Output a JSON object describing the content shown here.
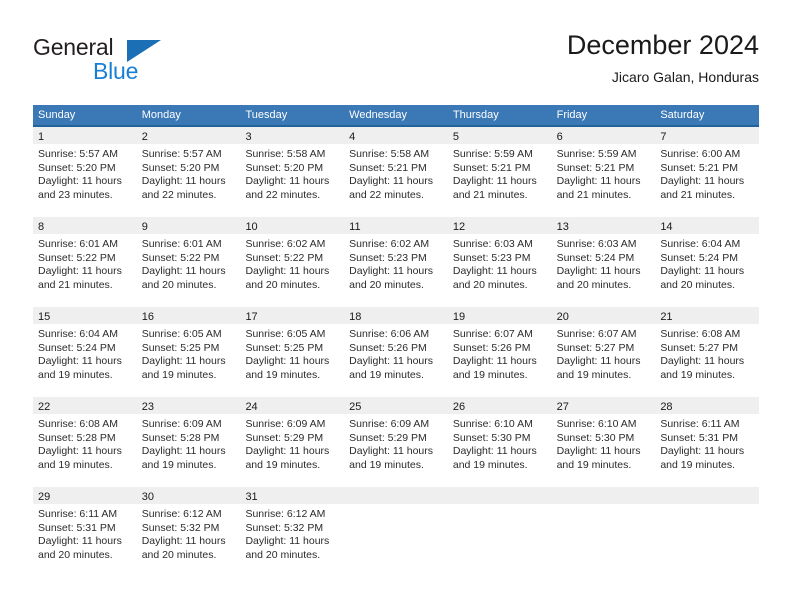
{
  "logo": {
    "word1": "General",
    "word2": "Blue",
    "triangle_color": "#1a6fb5",
    "blue_color": "#1a7fd4"
  },
  "header": {
    "title": "December 2024",
    "subtitle": "Jicaro Galan, Honduras"
  },
  "theme": {
    "header_bg": "#3b78b6",
    "row_divider": "#20639b",
    "daynum_bg": "#efefef",
    "text": "#2b2b2b"
  },
  "weekdays": [
    "Sunday",
    "Monday",
    "Tuesday",
    "Wednesday",
    "Thursday",
    "Friday",
    "Saturday"
  ],
  "weeks": [
    [
      {
        "day": "1",
        "sunrise": "Sunrise: 5:57 AM",
        "sunset": "Sunset: 5:20 PM",
        "daylight1": "Daylight: 11 hours",
        "daylight2": "and 23 minutes."
      },
      {
        "day": "2",
        "sunrise": "Sunrise: 5:57 AM",
        "sunset": "Sunset: 5:20 PM",
        "daylight1": "Daylight: 11 hours",
        "daylight2": "and 22 minutes."
      },
      {
        "day": "3",
        "sunrise": "Sunrise: 5:58 AM",
        "sunset": "Sunset: 5:20 PM",
        "daylight1": "Daylight: 11 hours",
        "daylight2": "and 22 minutes."
      },
      {
        "day": "4",
        "sunrise": "Sunrise: 5:58 AM",
        "sunset": "Sunset: 5:21 PM",
        "daylight1": "Daylight: 11 hours",
        "daylight2": "and 22 minutes."
      },
      {
        "day": "5",
        "sunrise": "Sunrise: 5:59 AM",
        "sunset": "Sunset: 5:21 PM",
        "daylight1": "Daylight: 11 hours",
        "daylight2": "and 21 minutes."
      },
      {
        "day": "6",
        "sunrise": "Sunrise: 5:59 AM",
        "sunset": "Sunset: 5:21 PM",
        "daylight1": "Daylight: 11 hours",
        "daylight2": "and 21 minutes."
      },
      {
        "day": "7",
        "sunrise": "Sunrise: 6:00 AM",
        "sunset": "Sunset: 5:21 PM",
        "daylight1": "Daylight: 11 hours",
        "daylight2": "and 21 minutes."
      }
    ],
    [
      {
        "day": "8",
        "sunrise": "Sunrise: 6:01 AM",
        "sunset": "Sunset: 5:22 PM",
        "daylight1": "Daylight: 11 hours",
        "daylight2": "and 21 minutes."
      },
      {
        "day": "9",
        "sunrise": "Sunrise: 6:01 AM",
        "sunset": "Sunset: 5:22 PM",
        "daylight1": "Daylight: 11 hours",
        "daylight2": "and 20 minutes."
      },
      {
        "day": "10",
        "sunrise": "Sunrise: 6:02 AM",
        "sunset": "Sunset: 5:22 PM",
        "daylight1": "Daylight: 11 hours",
        "daylight2": "and 20 minutes."
      },
      {
        "day": "11",
        "sunrise": "Sunrise: 6:02 AM",
        "sunset": "Sunset: 5:23 PM",
        "daylight1": "Daylight: 11 hours",
        "daylight2": "and 20 minutes."
      },
      {
        "day": "12",
        "sunrise": "Sunrise: 6:03 AM",
        "sunset": "Sunset: 5:23 PM",
        "daylight1": "Daylight: 11 hours",
        "daylight2": "and 20 minutes."
      },
      {
        "day": "13",
        "sunrise": "Sunrise: 6:03 AM",
        "sunset": "Sunset: 5:24 PM",
        "daylight1": "Daylight: 11 hours",
        "daylight2": "and 20 minutes."
      },
      {
        "day": "14",
        "sunrise": "Sunrise: 6:04 AM",
        "sunset": "Sunset: 5:24 PM",
        "daylight1": "Daylight: 11 hours",
        "daylight2": "and 20 minutes."
      }
    ],
    [
      {
        "day": "15",
        "sunrise": "Sunrise: 6:04 AM",
        "sunset": "Sunset: 5:24 PM",
        "daylight1": "Daylight: 11 hours",
        "daylight2": "and 19 minutes."
      },
      {
        "day": "16",
        "sunrise": "Sunrise: 6:05 AM",
        "sunset": "Sunset: 5:25 PM",
        "daylight1": "Daylight: 11 hours",
        "daylight2": "and 19 minutes."
      },
      {
        "day": "17",
        "sunrise": "Sunrise: 6:05 AM",
        "sunset": "Sunset: 5:25 PM",
        "daylight1": "Daylight: 11 hours",
        "daylight2": "and 19 minutes."
      },
      {
        "day": "18",
        "sunrise": "Sunrise: 6:06 AM",
        "sunset": "Sunset: 5:26 PM",
        "daylight1": "Daylight: 11 hours",
        "daylight2": "and 19 minutes."
      },
      {
        "day": "19",
        "sunrise": "Sunrise: 6:07 AM",
        "sunset": "Sunset: 5:26 PM",
        "daylight1": "Daylight: 11 hours",
        "daylight2": "and 19 minutes."
      },
      {
        "day": "20",
        "sunrise": "Sunrise: 6:07 AM",
        "sunset": "Sunset: 5:27 PM",
        "daylight1": "Daylight: 11 hours",
        "daylight2": "and 19 minutes."
      },
      {
        "day": "21",
        "sunrise": "Sunrise: 6:08 AM",
        "sunset": "Sunset: 5:27 PM",
        "daylight1": "Daylight: 11 hours",
        "daylight2": "and 19 minutes."
      }
    ],
    [
      {
        "day": "22",
        "sunrise": "Sunrise: 6:08 AM",
        "sunset": "Sunset: 5:28 PM",
        "daylight1": "Daylight: 11 hours",
        "daylight2": "and 19 minutes."
      },
      {
        "day": "23",
        "sunrise": "Sunrise: 6:09 AM",
        "sunset": "Sunset: 5:28 PM",
        "daylight1": "Daylight: 11 hours",
        "daylight2": "and 19 minutes."
      },
      {
        "day": "24",
        "sunrise": "Sunrise: 6:09 AM",
        "sunset": "Sunset: 5:29 PM",
        "daylight1": "Daylight: 11 hours",
        "daylight2": "and 19 minutes."
      },
      {
        "day": "25",
        "sunrise": "Sunrise: 6:09 AM",
        "sunset": "Sunset: 5:29 PM",
        "daylight1": "Daylight: 11 hours",
        "daylight2": "and 19 minutes."
      },
      {
        "day": "26",
        "sunrise": "Sunrise: 6:10 AM",
        "sunset": "Sunset: 5:30 PM",
        "daylight1": "Daylight: 11 hours",
        "daylight2": "and 19 minutes."
      },
      {
        "day": "27",
        "sunrise": "Sunrise: 6:10 AM",
        "sunset": "Sunset: 5:30 PM",
        "daylight1": "Daylight: 11 hours",
        "daylight2": "and 19 minutes."
      },
      {
        "day": "28",
        "sunrise": "Sunrise: 6:11 AM",
        "sunset": "Sunset: 5:31 PM",
        "daylight1": "Daylight: 11 hours",
        "daylight2": "and 19 minutes."
      }
    ],
    [
      {
        "day": "29",
        "sunrise": "Sunrise: 6:11 AM",
        "sunset": "Sunset: 5:31 PM",
        "daylight1": "Daylight: 11 hours",
        "daylight2": "and 20 minutes."
      },
      {
        "day": "30",
        "sunrise": "Sunrise: 6:12 AM",
        "sunset": "Sunset: 5:32 PM",
        "daylight1": "Daylight: 11 hours",
        "daylight2": "and 20 minutes."
      },
      {
        "day": "31",
        "sunrise": "Sunrise: 6:12 AM",
        "sunset": "Sunset: 5:32 PM",
        "daylight1": "Daylight: 11 hours",
        "daylight2": "and 20 minutes."
      },
      {
        "day": "",
        "sunrise": "",
        "sunset": "",
        "daylight1": "",
        "daylight2": ""
      },
      {
        "day": "",
        "sunrise": "",
        "sunset": "",
        "daylight1": "",
        "daylight2": ""
      },
      {
        "day": "",
        "sunrise": "",
        "sunset": "",
        "daylight1": "",
        "daylight2": ""
      },
      {
        "day": "",
        "sunrise": "",
        "sunset": "",
        "daylight1": "",
        "daylight2": ""
      }
    ]
  ]
}
